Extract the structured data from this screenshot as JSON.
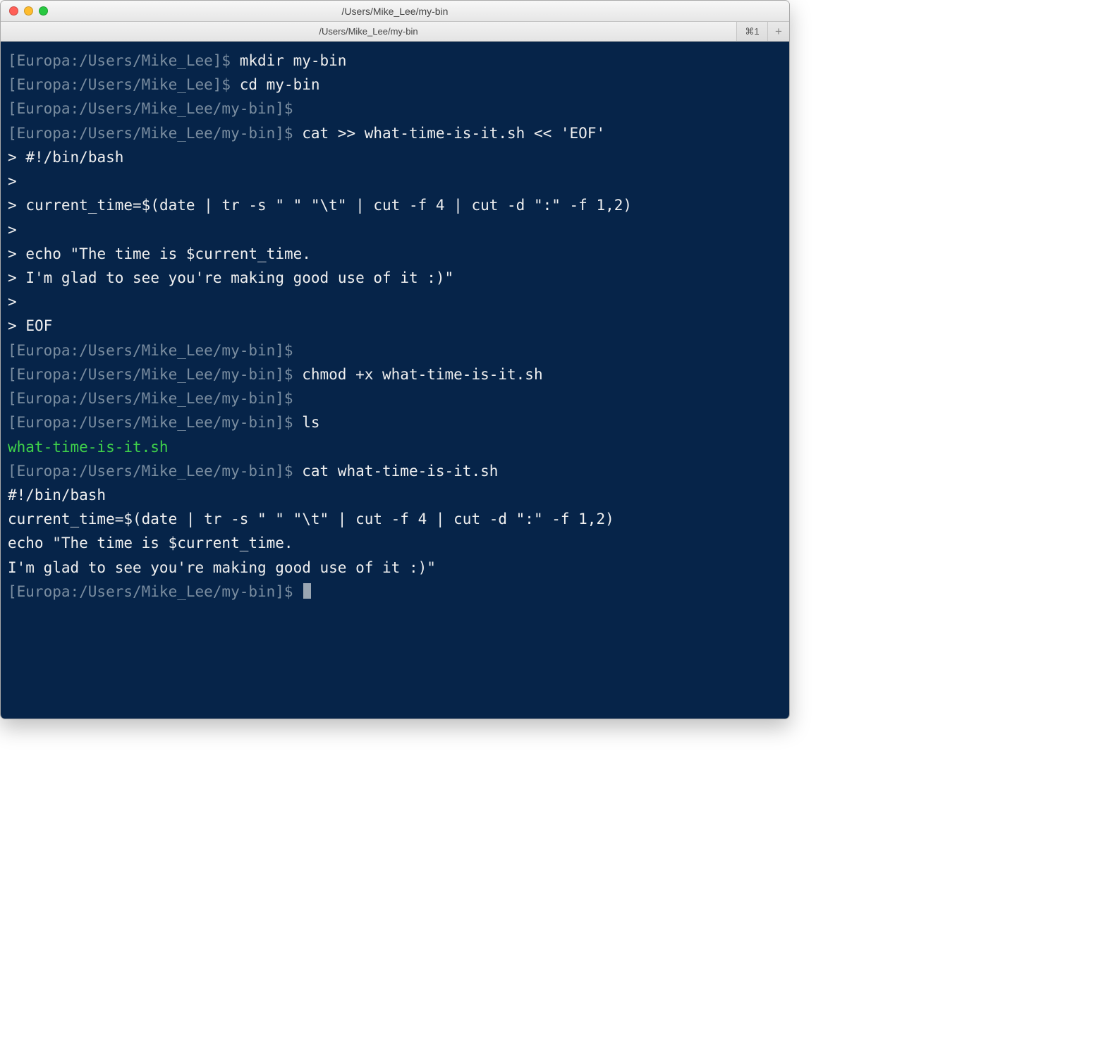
{
  "window": {
    "title": "/Users/Mike_Lee/my-bin"
  },
  "tabs": {
    "active_label": "/Users/Mike_Lee/my-bin",
    "shortcut": "⌘1",
    "add_label": "+"
  },
  "prompts": {
    "home": "[Europa:/Users/Mike_Lee]$",
    "bin": "[Europa:/Users/Mike_Lee/my-bin]$",
    "cont": ">"
  },
  "session": {
    "cmd_mkdir": "mkdir my-bin",
    "cmd_cd": "cd my-bin",
    "cmd_cat_heredoc": "cat >> what-time-is-it.sh << 'EOF'",
    "heredoc_l1": "#!/bin/bash",
    "heredoc_l2": "",
    "heredoc_l3": "current_time=$(date | tr -s \" \" \"\\t\" | cut -f 4 | cut -d \":\" -f 1,2)",
    "heredoc_l4": "",
    "heredoc_l5": "echo \"The time is $current_time.",
    "heredoc_l6": "I'm glad to see you're making good use of it :)\"",
    "heredoc_l7": "",
    "heredoc_l8": "EOF",
    "cmd_chmod": "chmod +x what-time-is-it.sh",
    "cmd_ls": "ls",
    "ls_out": "what-time-is-it.sh",
    "cmd_cat": "cat what-time-is-it.sh",
    "file_l1": "#!/bin/bash",
    "file_l2": "",
    "file_l3": "current_time=$(date | tr -s \" \" \"\\t\" | cut -f 4 | cut -d \":\" -f 1,2)",
    "file_l4": "",
    "file_l5": "echo \"The time is $current_time.",
    "file_l6": "I'm glad to see you're making good use of it :)\"",
    "file_l7": ""
  }
}
